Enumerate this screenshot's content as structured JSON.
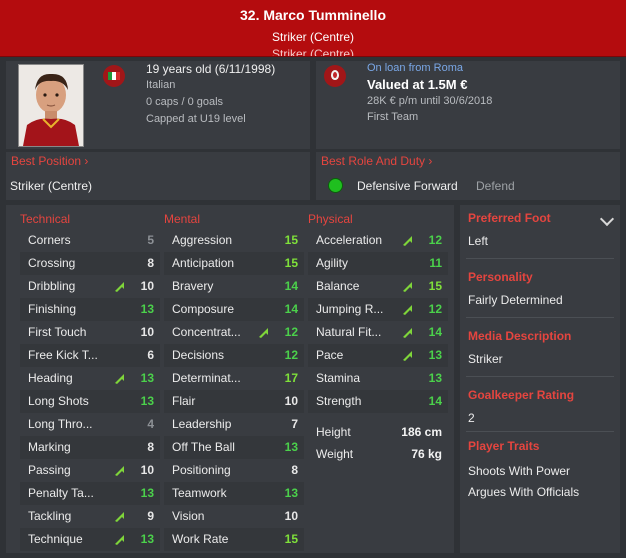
{
  "player": {
    "title": "32. Marco Tumminello",
    "position": "Striker (Centre)",
    "position_ghost": "Striker (Centre)"
  },
  "info_left": {
    "age": "19 years old (6/11/1998)",
    "nationality": "Italian",
    "caps": "0 caps / 0 goals",
    "capped": "Capped at U19 level"
  },
  "info_right": {
    "loan": "On loan from Roma",
    "value": "Valued at 1.5M €",
    "contract": "28K € p/m until 30/6/2018",
    "squad": "First Team"
  },
  "best_position": {
    "title": "Best Position",
    "value": "Striker (Centre)"
  },
  "best_role": {
    "title": "Best Role And Duty",
    "role": "Defensive Forward",
    "duty": "Defend"
  },
  "technical": {
    "title": "Technical",
    "rows": [
      {
        "label": "Corners",
        "value": "5",
        "color": "grey",
        "arrow": false
      },
      {
        "label": "Crossing",
        "value": "8",
        "color": "white",
        "arrow": false
      },
      {
        "label": "Dribbling",
        "value": "10",
        "color": "white",
        "arrow": true
      },
      {
        "label": "Finishing",
        "value": "13",
        "color": "green",
        "arrow": false
      },
      {
        "label": "First Touch",
        "value": "10",
        "color": "white",
        "arrow": false
      },
      {
        "label": "Free Kick T...",
        "value": "6",
        "color": "white",
        "arrow": false
      },
      {
        "label": "Heading",
        "value": "13",
        "color": "green",
        "arrow": true
      },
      {
        "label": "Long Shots",
        "value": "13",
        "color": "green",
        "arrow": false
      },
      {
        "label": "Long Thro...",
        "value": "4",
        "color": "grey",
        "arrow": false
      },
      {
        "label": "Marking",
        "value": "8",
        "color": "white",
        "arrow": false
      },
      {
        "label": "Passing",
        "value": "10",
        "color": "white",
        "arrow": true
      },
      {
        "label": "Penalty Ta...",
        "value": "13",
        "color": "green",
        "arrow": false
      },
      {
        "label": "Tackling",
        "value": "9",
        "color": "white",
        "arrow": true
      },
      {
        "label": "Technique",
        "value": "13",
        "color": "green",
        "arrow": true
      }
    ]
  },
  "mental": {
    "title": "Mental",
    "rows": [
      {
        "label": "Aggression",
        "value": "15",
        "color": "lime",
        "arrow": false
      },
      {
        "label": "Anticipation",
        "value": "15",
        "color": "lime",
        "arrow": false
      },
      {
        "label": "Bravery",
        "value": "14",
        "color": "green",
        "arrow": false
      },
      {
        "label": "Composure",
        "value": "14",
        "color": "green",
        "arrow": false
      },
      {
        "label": "Concentrat...",
        "value": "12",
        "color": "green",
        "arrow": true
      },
      {
        "label": "Decisions",
        "value": "12",
        "color": "green",
        "arrow": false
      },
      {
        "label": "Determinat...",
        "value": "17",
        "color": "lime",
        "arrow": false
      },
      {
        "label": "Flair",
        "value": "10",
        "color": "white",
        "arrow": false
      },
      {
        "label": "Leadership",
        "value": "7",
        "color": "white",
        "arrow": false
      },
      {
        "label": "Off The Ball",
        "value": "13",
        "color": "green",
        "arrow": false
      },
      {
        "label": "Positioning",
        "value": "8",
        "color": "white",
        "arrow": false
      },
      {
        "label": "Teamwork",
        "value": "13",
        "color": "green",
        "arrow": false
      },
      {
        "label": "Vision",
        "value": "10",
        "color": "white",
        "arrow": false
      },
      {
        "label": "Work Rate",
        "value": "15",
        "color": "lime",
        "arrow": false
      }
    ]
  },
  "physical": {
    "title": "Physical",
    "rows": [
      {
        "label": "Acceleration",
        "value": "12",
        "color": "green",
        "arrow": true
      },
      {
        "label": "Agility",
        "value": "11",
        "color": "green",
        "arrow": false
      },
      {
        "label": "Balance",
        "value": "15",
        "color": "lime",
        "arrow": true
      },
      {
        "label": "Jumping R...",
        "value": "12",
        "color": "green",
        "arrow": true
      },
      {
        "label": "Natural Fit...",
        "value": "14",
        "color": "green",
        "arrow": true
      },
      {
        "label": "Pace",
        "value": "13",
        "color": "green",
        "arrow": true
      },
      {
        "label": "Stamina",
        "value": "13",
        "color": "green",
        "arrow": false
      },
      {
        "label": "Strength",
        "value": "14",
        "color": "green",
        "arrow": false
      }
    ],
    "height_label": "Height",
    "height_value": "186 cm",
    "weight_label": "Weight",
    "weight_value": "76 kg"
  },
  "side": {
    "preferred_foot_title": "Preferred Foot",
    "preferred_foot": "Left",
    "personality_title": "Personality",
    "personality": "Fairly Determined",
    "media_title": "Media Description",
    "media": "Striker",
    "gk_title": "Goalkeeper Rating",
    "gk": "2",
    "traits_title": "Player Traits",
    "traits": [
      "Shoots With Power",
      "Argues With Officials"
    ]
  },
  "colors": {
    "header": "#b40c0e",
    "accent": "#e5453f",
    "green": "#4bd14b",
    "lime": "#7fe13a",
    "link": "#7aa7e6"
  },
  "icons": {
    "flag": "italy-flag-icon",
    "crest": "roma-crest-icon",
    "arrow": "trend-up-arrow-icon",
    "role": "role-suitability-dot-icon",
    "chevron": "chevron-down-icon"
  }
}
